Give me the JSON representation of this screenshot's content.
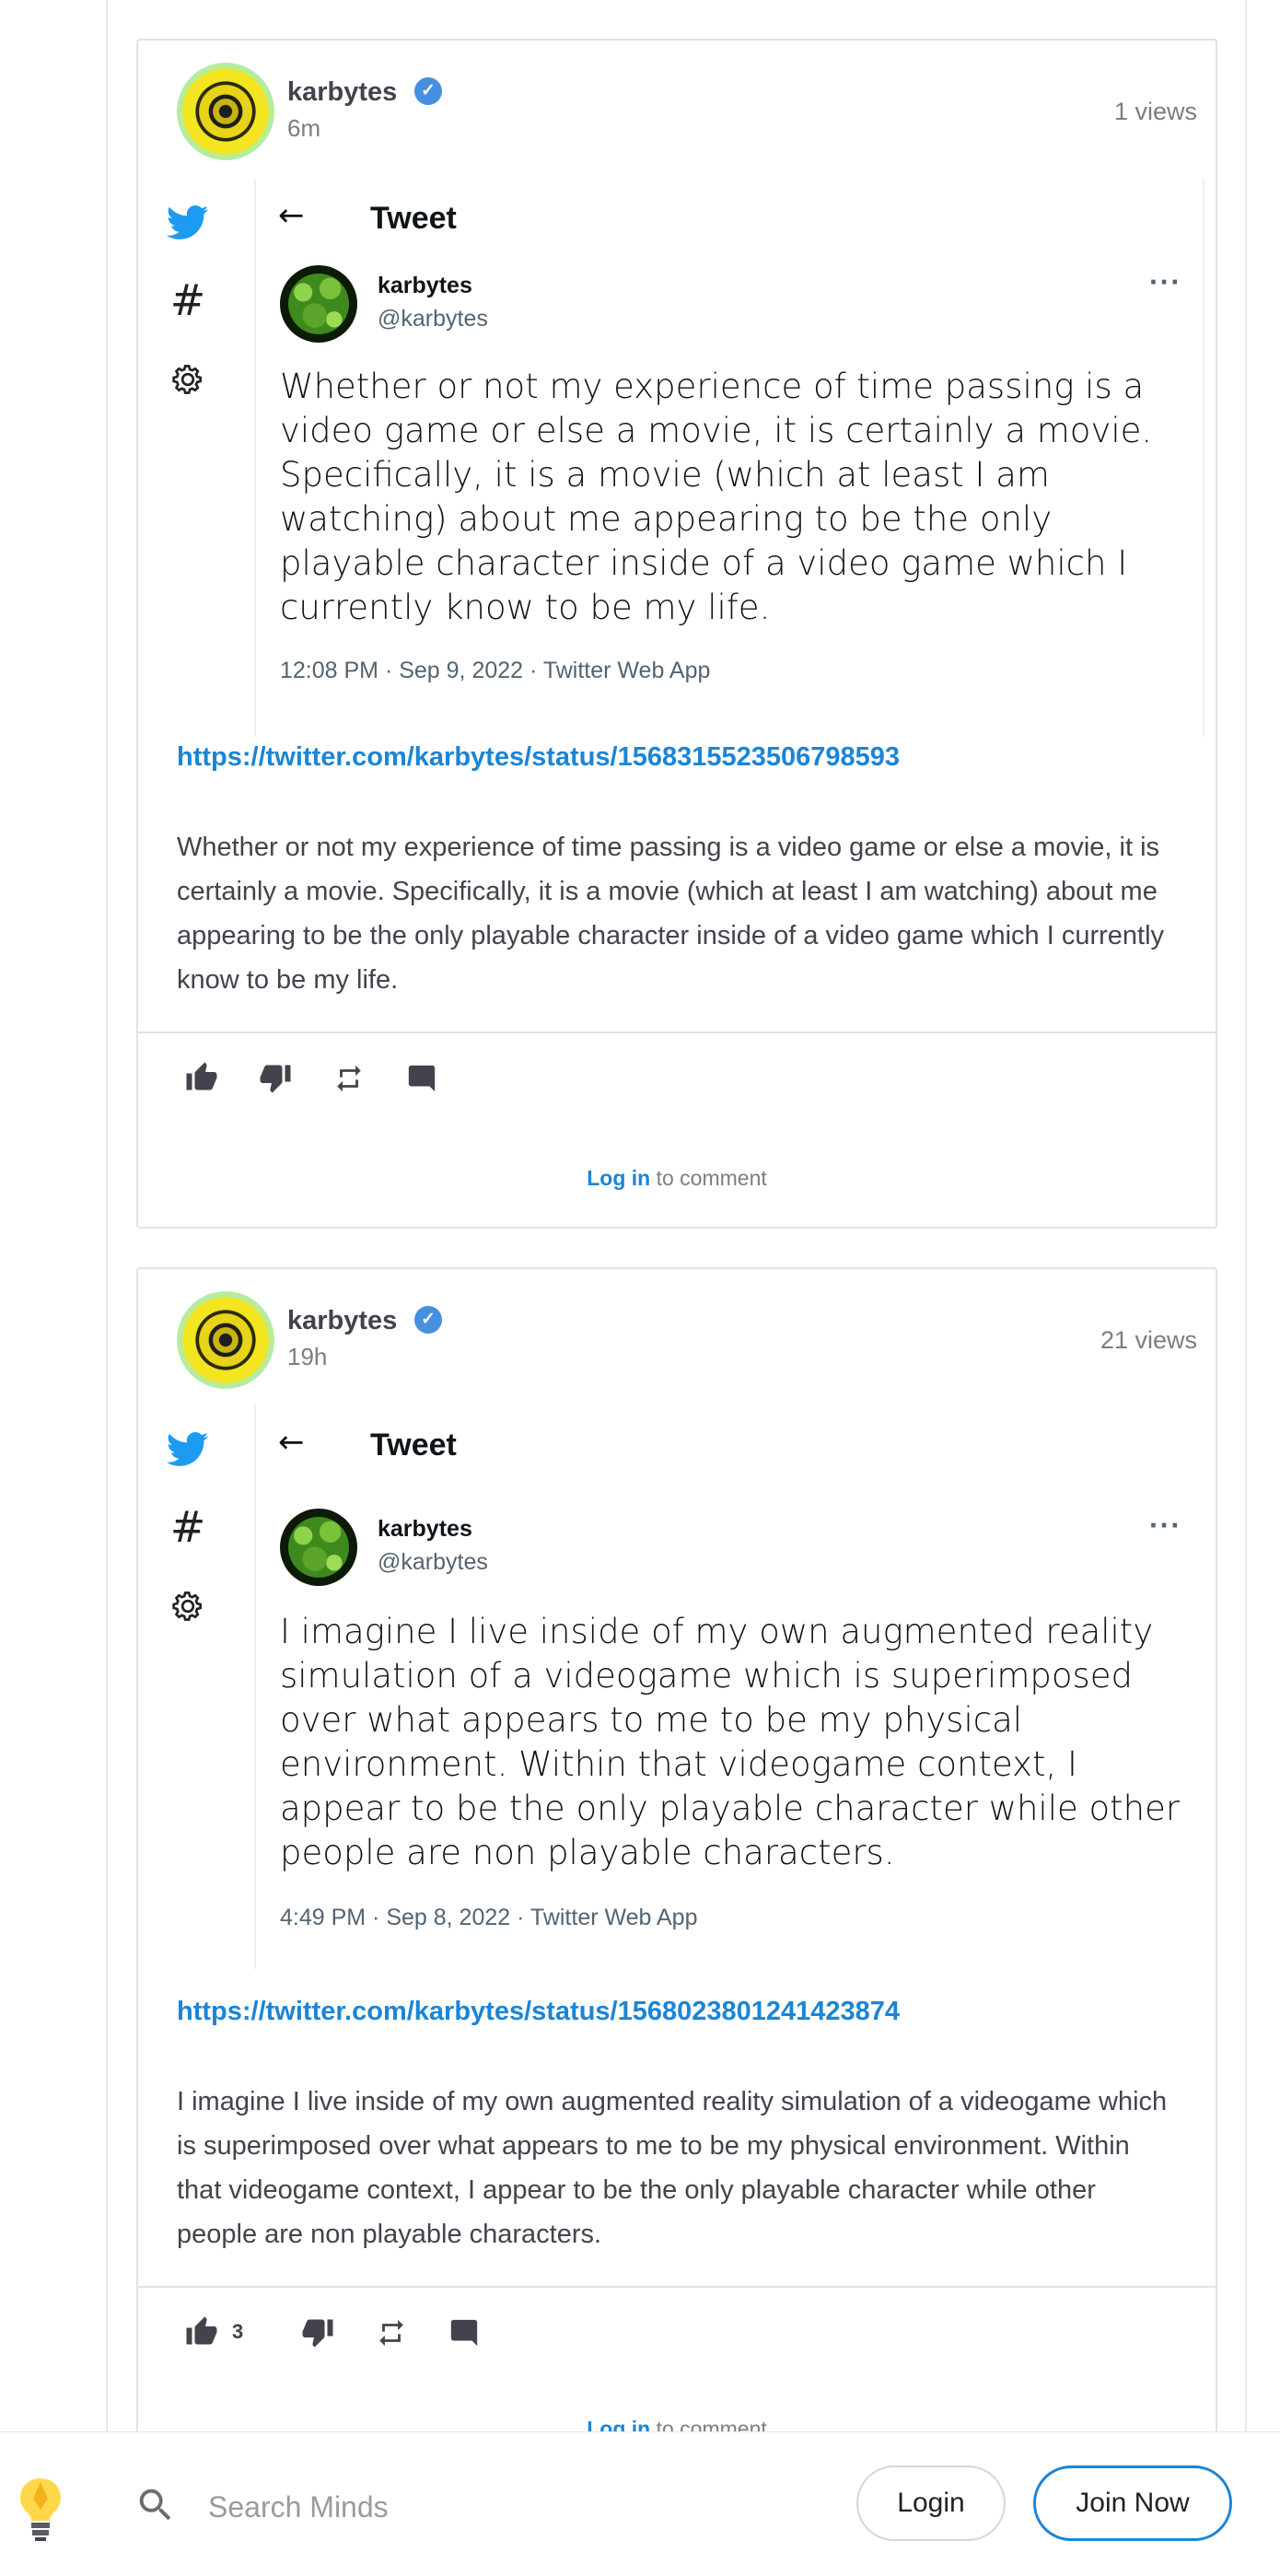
{
  "posts": [
    {
      "author": "karbytes",
      "time": "6m",
      "views": "1 views",
      "embed": {
        "back_label": "←",
        "title": "Tweet",
        "name": "karbytes",
        "handle": "@karbytes",
        "more": "···",
        "text": "Whether or not my experience of time passing is a video game or else a movie, it is certainly a movie. Specifically, it is a movie (which at least I am watching) about me appearing to be the only playable character inside of a video game which I currently know to be my life.",
        "meta": "12:08 PM · Sep 9, 2022 · Twitter Web App"
      },
      "link": "https://twitter.com/karbytes/status/1568315523506798593",
      "body": "Whether or not my experience of time passing is a video game or else a movie, it is certainly a movie. Specifically, it is a movie (which at least I am watching) about me appearing to be the only playable character inside of a video game which I currently know to be my life.",
      "likes": "",
      "comment_login": "Log in",
      "comment_rest": " to comment"
    },
    {
      "author": "karbytes",
      "time": "19h",
      "views": "21 views",
      "embed": {
        "back_label": "←",
        "title": "Tweet",
        "name": "karbytes",
        "handle": "@karbytes",
        "more": "···",
        "text": "I imagine I live inside of my own augmented reality simulation of a videogame which is superimposed over what appears to me to be my physical environment. Within that videogame context, I appear to be the only playable character while other people are non playable characters.",
        "meta": "4:49 PM · Sep 8, 2022 · Twitter Web App"
      },
      "link": "https://twitter.com/karbytes/status/1568023801241423874",
      "body": "I imagine I live inside of my own augmented reality simulation of a videogame which is superimposed over what appears to me to be my physical environment. Within that videogame context, I appear to be the only playable character while other people are non playable characters.",
      "likes": "3",
      "comment_login": "Log in",
      "comment_rest": " to comment"
    }
  ],
  "bottom_bar": {
    "search_placeholder": "Search Minds",
    "login_label": "Login",
    "join_label": "Join Now"
  },
  "colors": {
    "accent": "#1b85d6",
    "twitter_blue": "#1d9bf0",
    "verified": "#4690df"
  }
}
